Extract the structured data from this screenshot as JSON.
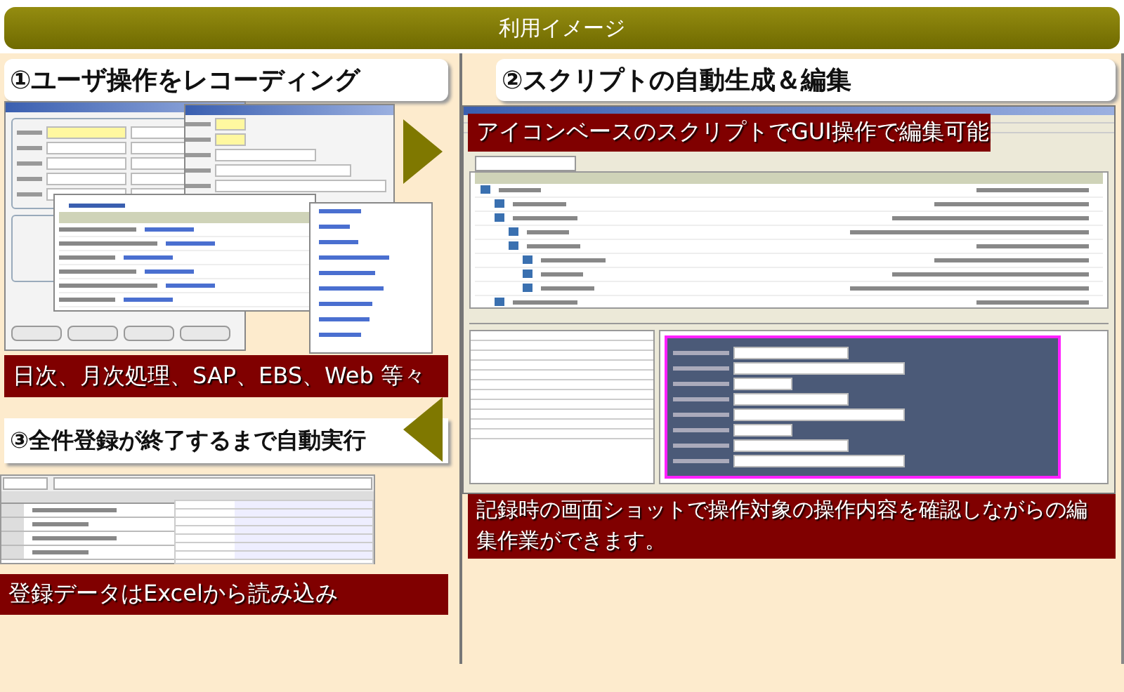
{
  "header": {
    "title": "利用イメージ"
  },
  "left": {
    "record": {
      "heading": "①ユーザ操作をレコーディング",
      "caption": "日次、月次処理、SAP、EBS、Web 等々"
    },
    "run": {
      "heading": "③全件登録が終了するまで自動実行",
      "caption": "登録データはExcelから読み込み"
    }
  },
  "right": {
    "heading": "②スクリプトの自動生成＆編集",
    "overlay_caption": "アイコンベースのスクリプトでGUI操作で編集可能",
    "caption": "記録時の画面ショットで操作対象の操作内容を確認しながらの編集作業ができます。"
  }
}
